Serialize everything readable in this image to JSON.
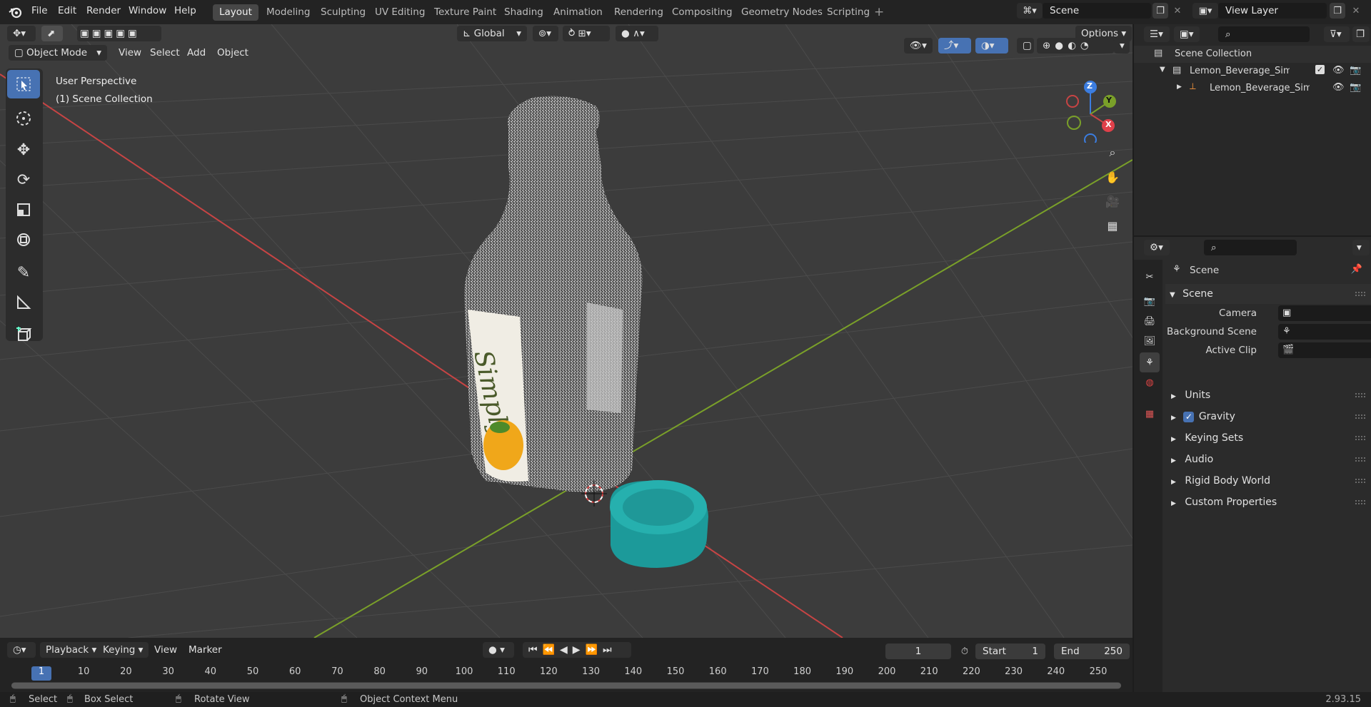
{
  "menus": [
    "File",
    "Edit",
    "Render",
    "Window",
    "Help"
  ],
  "workspaces": [
    "Layout",
    "Modeling",
    "Sculpting",
    "UV Editing",
    "Texture Paint",
    "Shading",
    "Animation",
    "Rendering",
    "Compositing",
    "Geometry Nodes",
    "Scripting"
  ],
  "active_workspace": "Layout",
  "scene": {
    "name": "Scene"
  },
  "view_layer": {
    "name": "View Layer"
  },
  "viewport": {
    "mode": "Object Mode",
    "menus": [
      "View",
      "Select",
      "Add",
      "Object"
    ],
    "transform_orientation": "Global",
    "options_label": "Options",
    "overlay_title": "User Perspective",
    "overlay_subtitle": "(1) Scene Collection",
    "gizmo_axes": {
      "z": "Z",
      "y": "Y",
      "x": "X"
    }
  },
  "outliner": {
    "root": "Scene Collection",
    "collection": "Lemon_Beverage_Simply_Le",
    "object": "Lemon_Beverage_Simply"
  },
  "properties": {
    "header": "Scene",
    "panel": "Scene",
    "fields": [
      {
        "label": "Camera"
      },
      {
        "label": "Background Scene"
      },
      {
        "label": "Active Clip"
      }
    ],
    "subpanels": [
      "Units",
      "Gravity",
      "Keying Sets",
      "Audio",
      "Rigid Body World",
      "Custom Properties"
    ],
    "gravity_checked": true
  },
  "timeline": {
    "menus": [
      "Playback",
      "Keying",
      "View",
      "Marker"
    ],
    "current_frame": "1",
    "start_label": "Start",
    "start": "1",
    "end_label": "End",
    "end": "250",
    "ticks": [
      "1",
      "10",
      "20",
      "30",
      "40",
      "50",
      "60",
      "70",
      "80",
      "90",
      "100",
      "110",
      "120",
      "130",
      "140",
      "150",
      "160",
      "170",
      "180",
      "190",
      "200",
      "210",
      "220",
      "230",
      "240",
      "250"
    ]
  },
  "statusbar": {
    "select": "Select",
    "box_select": "Box Select",
    "rotate": "Rotate View",
    "context": "Object Context Menu",
    "version": "2.93.15"
  },
  "colors": {
    "accent": "#4772b3",
    "x_axis": "#c74444",
    "y_axis": "#7aa029",
    "cap": "#20a5a5"
  }
}
